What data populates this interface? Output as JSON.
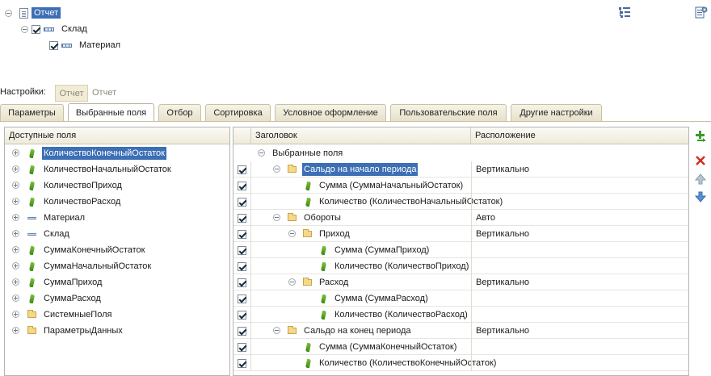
{
  "structure_tree": {
    "root_label": "Отчет",
    "child_label": "Склад",
    "grandchild_label": "Материал"
  },
  "settings": {
    "label": "Настройки:",
    "button_label": "Отчет",
    "value": "Отчет"
  },
  "tabs": [
    {
      "label": "Параметры"
    },
    {
      "label": "Выбранные поля"
    },
    {
      "label": "Отбор"
    },
    {
      "label": "Сортировка"
    },
    {
      "label": "Условное оформление"
    },
    {
      "label": "Пользовательские поля"
    },
    {
      "label": "Другие настройки"
    }
  ],
  "available_fields": {
    "header": "Доступные поля",
    "items": [
      {
        "label": "КоличествоКонечныйОстаток",
        "icon": "resource-icon",
        "selected": true
      },
      {
        "label": "КоличествоНачальныйОстаток",
        "icon": "resource-icon"
      },
      {
        "label": "КоличествоПриход",
        "icon": "resource-icon"
      },
      {
        "label": "КоличествоРасход",
        "icon": "resource-icon"
      },
      {
        "label": "Материал",
        "icon": "dimension-icon"
      },
      {
        "label": "Склад",
        "icon": "dimension-icon"
      },
      {
        "label": "СуммаКонечныйОстаток",
        "icon": "resource-icon"
      },
      {
        "label": "СуммаНачальныйОстаток",
        "icon": "resource-icon"
      },
      {
        "label": "СуммаПриход",
        "icon": "resource-icon"
      },
      {
        "label": "СуммаРасход",
        "icon": "resource-icon"
      },
      {
        "label": "СистемныеПоля",
        "icon": "folder-icon"
      },
      {
        "label": "ПараметрыДанных",
        "icon": "folder-icon"
      }
    ]
  },
  "selected_fields": {
    "header_title": "Заголовок",
    "header_location": "Расположение",
    "root_label": "Выбранные поля",
    "rows": [
      {
        "label": "Сальдо на начало периода",
        "location": "Вертикально"
      },
      {
        "label": "Сумма (СуммаНачальныйОстаток)",
        "location": ""
      },
      {
        "label": "Количество (КоличествоНачальныйОстаток)",
        "location": ""
      },
      {
        "label": "Обороты",
        "location": "Авто"
      },
      {
        "label": "Приход",
        "location": "Вертикально"
      },
      {
        "label": "Сумма (СуммаПриход)",
        "location": ""
      },
      {
        "label": "Количество (КоличествоПриход)",
        "location": ""
      },
      {
        "label": "Расход",
        "location": "Вертикально"
      },
      {
        "label": "Сумма (СуммаРасход)",
        "location": ""
      },
      {
        "label": "Количество (КоличествоРасход)",
        "location": ""
      },
      {
        "label": "Сальдо на конец периода",
        "location": "Вертикально"
      },
      {
        "label": "Сумма (СуммаКонечныйОстаток)",
        "location": ""
      },
      {
        "label": "Количество (КоличествоКонечныйОстаток)",
        "location": ""
      }
    ]
  },
  "colors": {
    "selection": "#3c6fb5",
    "tab_bg": "#e7e1cb",
    "add_icon": "#3a9a2a",
    "delete_icon": "#d03020",
    "arrow_icon": "#4a7ec0"
  }
}
